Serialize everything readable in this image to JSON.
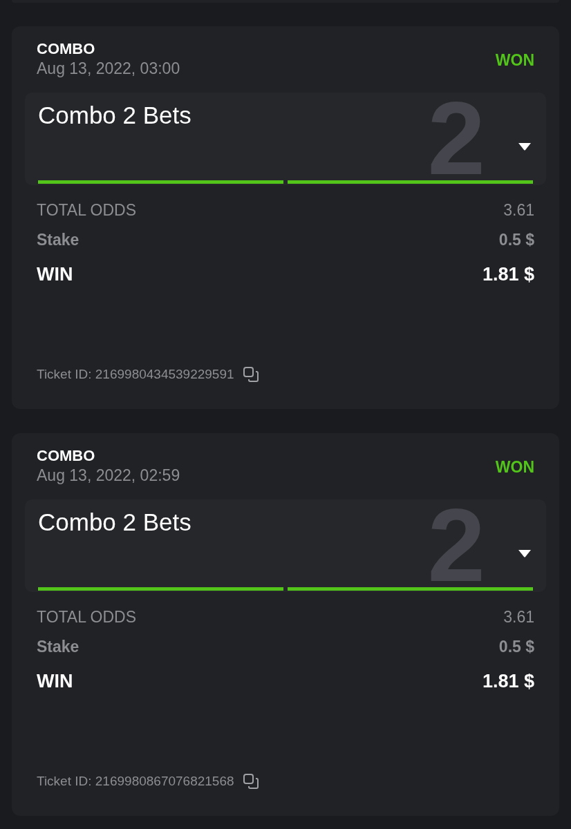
{
  "tickets": [
    {
      "type": "COMBO",
      "date": "Aug 13, 2022, 03:00",
      "status": "WON",
      "kind": "won",
      "title": "Combo 2 Bets",
      "legs_count": "2",
      "legs": [
        {
          "won": true
        },
        {
          "won": true
        }
      ],
      "total_odds_label": "TOTAL ODDS",
      "total_odds": "3.61",
      "stake_label": "Stake",
      "stake": "0.5 $",
      "win_label": "WIN",
      "win": "1.81 $",
      "ticket_id": "Ticket ID: 2169980434539229591"
    },
    {
      "type": "COMBO",
      "date": "Aug 13, 2022, 02:59",
      "status": "WON",
      "kind": "won",
      "title": "Combo 2 Bets",
      "legs_count": "2",
      "legs": [
        {
          "won": true
        },
        {
          "won": true
        }
      ],
      "total_odds_label": "TOTAL ODDS",
      "total_odds": "3.61",
      "stake_label": "Stake",
      "stake": "0.5 $",
      "win_label": "WIN",
      "win": "1.81 $",
      "ticket_id": "Ticket ID: 2169980867076821568"
    }
  ]
}
